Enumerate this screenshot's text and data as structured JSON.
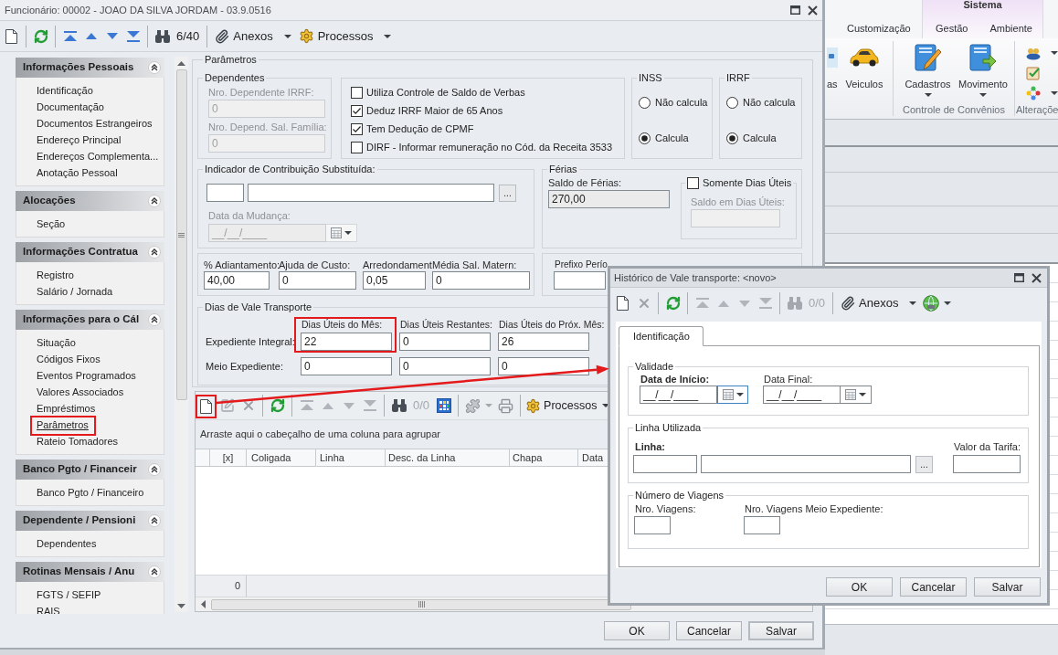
{
  "main_window": {
    "title": "Funcionário: 00002 - JOAO DA SILVA JORDAM - 03.9.0516",
    "toolbar": {
      "items": [
        {
          "kind": "icon",
          "disabled": false
        },
        {
          "kind": "separator"
        },
        {
          "kind": "icon",
          "disabled": false
        },
        {
          "kind": "separator"
        },
        {
          "kind": "icon",
          "disabled": false
        },
        {
          "kind": "icon",
          "disabled": false
        },
        {
          "kind": "icon",
          "disabled": false
        },
        {
          "kind": "icon",
          "disabled": false
        },
        {
          "kind": "separator"
        },
        {
          "kind": "icon",
          "disabled": false
        },
        {
          "kind": "counter",
          "text": "6/40",
          "disabled": false
        },
        {
          "kind": "separator"
        },
        {
          "kind": "menu",
          "label": "Anexos"
        },
        {
          "kind": "menu",
          "label": "Processos"
        }
      ]
    },
    "sidebar": {
      "groups": [
        {
          "title": "Informações Pessoais",
          "expanded": true,
          "items": [
            {
              "label": "Identificação",
              "selected": false,
              "highlighted": false
            },
            {
              "label": "Documentação",
              "selected": false,
              "highlighted": false
            },
            {
              "label": "Documentos Estrangeiros",
              "selected": false,
              "highlighted": false
            },
            {
              "label": "Endereço Principal",
              "selected": false,
              "highlighted": false
            },
            {
              "label": "Endereços Complementa...",
              "selected": false,
              "highlighted": false
            },
            {
              "label": "Anotação Pessoal",
              "selected": false,
              "highlighted": false
            }
          ]
        },
        {
          "title": "Alocações",
          "expanded": true,
          "items": [
            {
              "label": "Seção",
              "selected": false,
              "highlighted": false
            }
          ]
        },
        {
          "title": "Informações Contratua",
          "expanded": true,
          "items": [
            {
              "label": "Registro",
              "selected": false,
              "highlighted": false
            },
            {
              "label": "Salário / Jornada",
              "selected": false,
              "highlighted": false
            }
          ]
        },
        {
          "title": "Informações para o Cál",
          "expanded": true,
          "items": [
            {
              "label": "Situação",
              "selected": false,
              "highlighted": false
            },
            {
              "label": "Códigos Fixos",
              "selected": false,
              "highlighted": false
            },
            {
              "label": "Eventos Programados",
              "selected": false,
              "highlighted": false
            },
            {
              "label": "Valores Associados",
              "selected": false,
              "highlighted": false
            },
            {
              "label": "Empréstimos",
              "selected": false,
              "highlighted": false
            },
            {
              "label": "Parâmetros",
              "selected": true,
              "highlighted": true
            },
            {
              "label": "Rateio Tomadores",
              "selected": false,
              "highlighted": false
            }
          ]
        },
        {
          "title": "Banco Pgto / Financeir",
          "expanded": true,
          "items": [
            {
              "label": "Banco Pgto / Financeiro",
              "selected": false,
              "highlighted": false
            }
          ]
        },
        {
          "title": "Dependente / Pensioni",
          "expanded": true,
          "items": [
            {
              "label": "Dependentes",
              "selected": false,
              "highlighted": false
            }
          ]
        },
        {
          "title": "Rotinas Mensais / Anu",
          "expanded": true,
          "items": [
            {
              "label": "FGTS / SEFIP",
              "selected": false,
              "highlighted": false
            },
            {
              "label": "RAIS",
              "selected": false,
              "highlighted": false
            }
          ]
        }
      ]
    },
    "parameters": {
      "title": "Parâmetros",
      "dependents": {
        "title": "Dependentes",
        "fields": [
          {
            "label": "Nro. Dependente IRRF:",
            "value": "0",
            "disabled": true
          },
          {
            "label": "Nro. Depend. Sal. Família:",
            "value": "0",
            "disabled": true
          }
        ]
      },
      "options": [
        {
          "label": "Utiliza Controle de Saldo de Verbas",
          "checked": false
        },
        {
          "label": "Deduz IRRF Maior de 65 Anos",
          "checked": true
        },
        {
          "label": "Tem Dedução de CPMF",
          "checked": true
        },
        {
          "label": "DIRF - Informar remuneração no Cód. da Receita 3533",
          "checked": false
        }
      ],
      "inss": {
        "title": "INSS",
        "options": [
          {
            "label": "Não calcula",
            "selected": false
          },
          {
            "label": "Calcula",
            "selected": true
          }
        ]
      },
      "irrf": {
        "title": "IRRF",
        "options": [
          {
            "label": "Não calcula",
            "selected": false
          },
          {
            "label": "Calcula",
            "selected": true
          }
        ]
      },
      "contribution_indicator": {
        "title": "Indicador de Contribuição Substituída:",
        "lookup_label": "...",
        "date": {
          "label": "Data da Mudança:",
          "value": "__/__/____",
          "disabled": true
        }
      },
      "vacation": {
        "title": "Férias",
        "balance": {
          "label": "Saldo de Férias:",
          "value": "270,00",
          "read_only": true
        },
        "working_days_only": {
          "label": "Somente Dias Úteis",
          "checked": false
        },
        "working_days_balance": {
          "label": "Saldo em Dias Úteis:",
          "disabled": true
        }
      },
      "amounts": [
        {
          "label": "% Adiantamento:",
          "value": "40,00"
        },
        {
          "label": "Ajuda de Custo:",
          "value": "0"
        },
        {
          "label": "Arredondament",
          "value": "0,05"
        },
        {
          "label": "Média Sal. Matern:",
          "value": "0"
        }
      ],
      "esocial_prefix": {
        "label": "Prefixo Perío"
      },
      "transport_days": {
        "title": "Dias de Vale Transporte",
        "columns": [
          {
            "label": "Dias Úteis do Mês:",
            "highlighted": true
          },
          {
            "label": "Dias Úteis Restantes:",
            "highlighted": false
          },
          {
            "label": "Dias Úteis do Próx. Mês:",
            "highlighted": false
          }
        ],
        "rows": [
          {
            "label": "Expediente Integral:",
            "values": [
              "22",
              "0",
              "26"
            ]
          },
          {
            "label": "Meio Expediente:",
            "values": [
              "0",
              "0",
              "0"
            ]
          }
        ]
      }
    },
    "grid": {
      "toolbar": {
        "items": [
          {
            "kind": "icon",
            "disabled": false,
            "highlighted": true
          },
          {
            "kind": "icon",
            "disabled": true,
            "highlighted": false
          },
          {
            "kind": "icon",
            "disabled": true,
            "highlighted": false
          },
          {
            "kind": "separator"
          },
          {
            "kind": "icon",
            "disabled": false,
            "highlighted": false
          },
          {
            "kind": "separator"
          },
          {
            "kind": "icon",
            "disabled": true,
            "highlighted": false
          },
          {
            "kind": "icon",
            "disabled": true,
            "highlighted": false
          },
          {
            "kind": "icon",
            "disabled": true,
            "highlighted": false
          },
          {
            "kind": "icon",
            "disabled": true,
            "highlighted": false
          },
          {
            "kind": "separator"
          },
          {
            "kind": "icon",
            "disabled": false,
            "highlighted": false
          },
          {
            "kind": "counter",
            "text": "0/0",
            "disabled": true
          },
          {
            "kind": "icon",
            "disabled": false,
            "highlighted": false
          },
          {
            "kind": "separator"
          },
          {
            "kind": "icon_menu",
            "disabled": true
          },
          {
            "kind": "icon",
            "disabled": true,
            "highlighted": false
          },
          {
            "kind": "separator"
          },
          {
            "kind": "menu",
            "label": "Processos"
          }
        ]
      },
      "group_hint": "Arraste aqui o cabeçalho de uma coluna para agrupar",
      "columns": [
        {
          "label": "[x]"
        },
        {
          "label": "Coligada"
        },
        {
          "label": "Linha"
        },
        {
          "label": "Desc. da Linha"
        },
        {
          "label": "Chapa"
        },
        {
          "label": "Data"
        }
      ],
      "footer_count": "0"
    },
    "buttons": [
      {
        "label": "OK",
        "default": false
      },
      {
        "label": "Cancelar",
        "default": false
      },
      {
        "label": "Salvar",
        "default": true
      }
    ]
  },
  "dialog": {
    "title": "Histórico de Vale transporte: <novo>",
    "toolbar": {
      "items": [
        {
          "kind": "icon",
          "disabled": false
        },
        {
          "kind": "icon",
          "disabled": true
        },
        {
          "kind": "separator"
        },
        {
          "kind": "icon",
          "disabled": false
        },
        {
          "kind": "separator"
        },
        {
          "kind": "icon",
          "disabled": true
        },
        {
          "kind": "icon",
          "disabled": true
        },
        {
          "kind": "icon",
          "disabled": true
        },
        {
          "kind": "icon",
          "disabled": true
        },
        {
          "kind": "separator"
        },
        {
          "kind": "icon",
          "disabled": true
        },
        {
          "kind": "counter",
          "text": "0/0",
          "disabled": true
        },
        {
          "kind": "separator"
        },
        {
          "kind": "menu",
          "label": "Anexos"
        },
        {
          "kind": "icon_menu",
          "disabled": false
        }
      ]
    },
    "tabs": [
      {
        "label": "Identificação",
        "selected": true
      }
    ],
    "validity": {
      "title": "Validade",
      "fields": [
        {
          "label": "Data de Início:",
          "value": "__/__/____",
          "required": true,
          "focused": true
        },
        {
          "label": "Data Final:",
          "value": "__/__/____",
          "required": false,
          "focused": false
        }
      ]
    },
    "line": {
      "title": "Linha Utilizada",
      "fields": [
        {
          "kind": "lookup",
          "label": "Linha:",
          "required": true,
          "lookup_label": "..."
        },
        {
          "kind": "text",
          "label": "Valor da Tarifa:",
          "required": false
        }
      ]
    },
    "trips": {
      "title": "Número de Viagens",
      "fields": [
        {
          "label": "Nro. Viagens:",
          "required": false
        },
        {
          "label": "Nro. Viagens Meio Expediente:",
          "required": false
        }
      ]
    },
    "buttons": [
      {
        "label": "OK"
      },
      {
        "label": "Cancelar"
      },
      {
        "label": "Salvar"
      }
    ]
  },
  "background_app": {
    "ribbon_tabs": [
      {
        "label": "Customização",
        "selected": false
      }
    ],
    "context_tabs": {
      "title": "Sistema",
      "tabs": [
        {
          "label": "Gestão",
          "selected": false
        },
        {
          "label": "Ambiente",
          "selected": false
        }
      ]
    },
    "ribbon_groups": [
      {
        "buttons": [
          {
            "label": "as",
            "menu": false
          },
          {
            "label": "Veiculos",
            "menu": false
          }
        ]
      },
      {
        "label": "Controle de Convênios",
        "buttons": [
          {
            "label": "Cadastros",
            "menu": true
          },
          {
            "label": "Movimento",
            "menu": true
          }
        ]
      },
      {
        "label": "Alteraçõe",
        "small_buttons": [
          {
            "menu": true
          },
          {
            "menu": false
          },
          {
            "menu": true
          }
        ]
      }
    ]
  }
}
